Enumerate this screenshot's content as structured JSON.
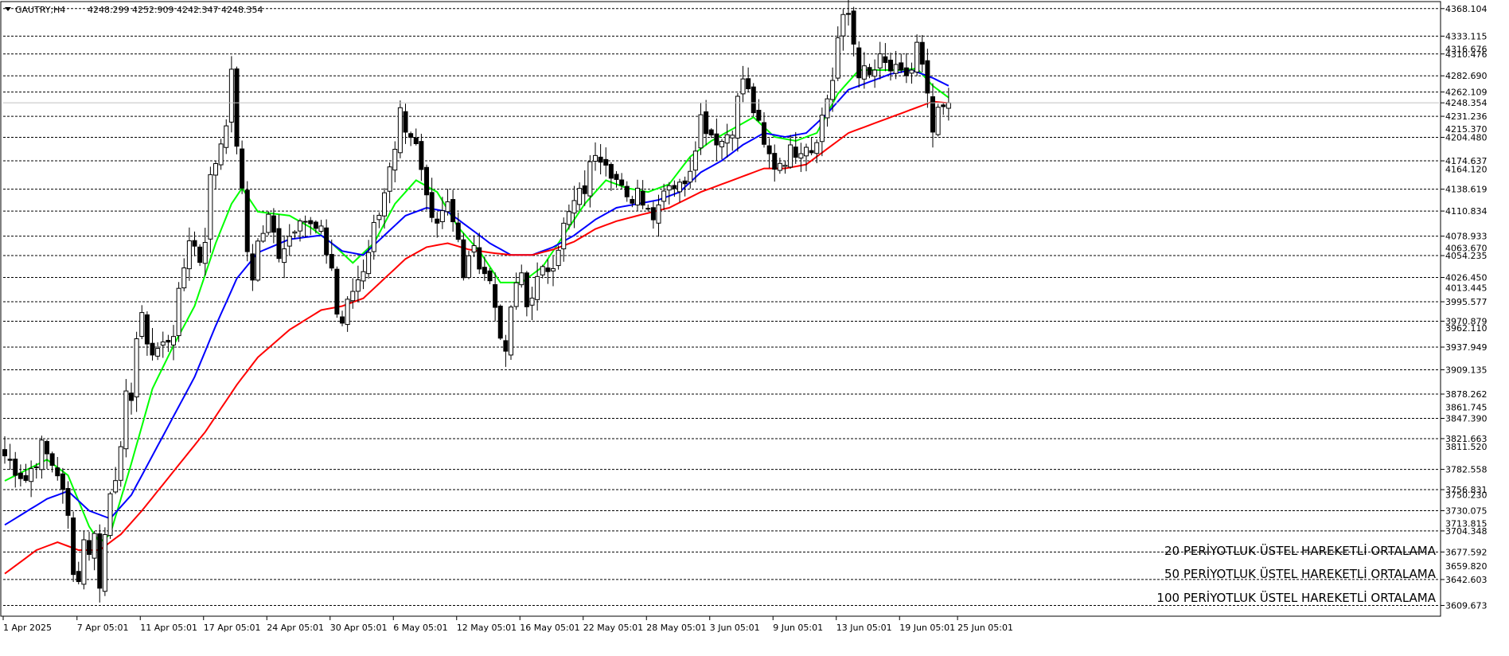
{
  "header": {
    "symbol": "GAUTRY,H4",
    "ohlc": "4248.299 4252.909 4242.347 4248.354",
    "menu_icon": "triangle-down-icon"
  },
  "chart_data": {
    "type": "candlestick",
    "title": "GAUTRY,H4",
    "ylim": [
      3596,
      4377
    ],
    "x_count": 181,
    "current_price": "4248.354",
    "price_levels_dashed": [
      4368.104,
      4333.115,
      4310.476,
      4282.69,
      4262.109,
      4231.236,
      4204.48,
      4174.637,
      4138.619,
      4110.834,
      4078.933,
      4054.235,
      4026.45,
      3995.577,
      3970.879,
      3937.949,
      3909.135,
      3878.262,
      3847.39,
      3821.663,
      3782.558,
      3756.831,
      3730.075,
      3704.348,
      3677.592,
      3642.603,
      3609.673
    ],
    "price_labels_major": [
      "4368.104",
      "4333.115",
      "4310.476",
      "4282.690",
      "4262.109",
      "4248.354",
      "4231.236",
      "4204.480",
      "4174.637",
      "4138.619",
      "4110.834",
      "4078.933",
      "4054.235",
      "4026.450",
      "3995.577",
      "3970.879",
      "3937.949",
      "3909.135",
      "3878.262",
      "3847.390",
      "3821.663",
      "3782.558",
      "3756.831",
      "3730.075",
      "3704.348",
      "3677.592",
      "3642.603",
      "3609.673"
    ],
    "price_labels_minor": [
      "4316.676",
      "4215.370",
      "4164.120",
      "4063.670",
      "4013.445",
      "3962.110",
      "3861.745",
      "3811.520",
      "3750.230",
      "3713.815",
      "3659.820"
    ],
    "x_labels": [
      {
        "label": "1 Apr 2025",
        "i": 0
      },
      {
        "label": "7 Apr 05:01",
        "i": 14
      },
      {
        "label": "11 Apr 05:01",
        "i": 26
      },
      {
        "label": "17 Apr 05:01",
        "i": 38
      },
      {
        "label": "24 Apr 05:01",
        "i": 50
      },
      {
        "label": "30 Apr 05:01",
        "i": 62
      },
      {
        "label": "6 May 05:01",
        "i": 74
      },
      {
        "label": "12 May 05:01",
        "i": 86
      },
      {
        "label": "16 May 05:01",
        "i": 98
      },
      {
        "label": "22 May 05:01",
        "i": 110
      },
      {
        "label": "28 May 05:01",
        "i": 122
      },
      {
        "label": "3 Jun 05:01",
        "i": 134
      },
      {
        "label": "9 Jun 05:01",
        "i": 146
      },
      {
        "label": "13 Jun 05:01",
        "i": 158
      },
      {
        "label": "19 Jun 05:01",
        "i": 170
      },
      {
        "label": "25 Jun 05:01",
        "i": 181
      }
    ],
    "close_path": [
      [
        0,
        3800
      ],
      [
        4,
        3770
      ],
      [
        7,
        3810
      ],
      [
        10,
        3780
      ],
      [
        12,
        3720
      ],
      [
        13,
        3660
      ],
      [
        14,
        3640
      ],
      [
        15,
        3700
      ],
      [
        16,
        3670
      ],
      [
        17,
        3710
      ],
      [
        18,
        3630
      ],
      [
        19,
        3700
      ],
      [
        20,
        3760
      ],
      [
        22,
        3800
      ],
      [
        23,
        3870
      ],
      [
        24,
        3880
      ],
      [
        25,
        3950
      ],
      [
        26,
        3970
      ],
      [
        28,
        3930
      ],
      [
        30,
        3940
      ],
      [
        32,
        3960
      ],
      [
        33,
        4000
      ],
      [
        34,
        4040
      ],
      [
        35,
        4080
      ],
      [
        37,
        4050
      ],
      [
        38,
        4080
      ],
      [
        39,
        4150
      ],
      [
        41,
        4200
      ],
      [
        42,
        4230
      ],
      [
        43,
        4280
      ],
      [
        44,
        4200
      ],
      [
        45,
        4130
      ],
      [
        46,
        4060
      ],
      [
        47,
        4030
      ],
      [
        48,
        4070
      ],
      [
        50,
        4100
      ],
      [
        52,
        4060
      ],
      [
        54,
        4080
      ],
      [
        56,
        4110
      ],
      [
        58,
        4090
      ],
      [
        60,
        4080
      ],
      [
        62,
        4040
      ],
      [
        63,
        3980
      ],
      [
        64,
        3970
      ],
      [
        66,
        4010
      ],
      [
        68,
        4040
      ],
      [
        70,
        4090
      ],
      [
        72,
        4140
      ],
      [
        74,
        4180
      ],
      [
        75,
        4230
      ],
      [
        76,
        4200
      ],
      [
        78,
        4190
      ],
      [
        80,
        4130
      ],
      [
        82,
        4100
      ],
      [
        84,
        4130
      ],
      [
        86,
        4070
      ],
      [
        87,
        4020
      ],
      [
        88,
        4060
      ],
      [
        90,
        4050
      ],
      [
        92,
        4020
      ],
      [
        93,
        3990
      ],
      [
        94,
        3960
      ],
      [
        95,
        3920
      ],
      [
        96,
        3990
      ],
      [
        98,
        4030
      ],
      [
        99,
        3990
      ],
      [
        100,
        4010
      ],
      [
        102,
        4030
      ],
      [
        104,
        4050
      ],
      [
        106,
        4090
      ],
      [
        108,
        4120
      ],
      [
        110,
        4140
      ],
      [
        112,
        4190
      ],
      [
        114,
        4180
      ],
      [
        116,
        4150
      ],
      [
        118,
        4120
      ],
      [
        120,
        4140
      ],
      [
        122,
        4120
      ],
      [
        123,
        4100
      ],
      [
        124,
        4130
      ],
      [
        126,
        4150
      ],
      [
        128,
        4140
      ],
      [
        130,
        4170
      ],
      [
        132,
        4230
      ],
      [
        133,
        4220
      ],
      [
        134,
        4210
      ],
      [
        136,
        4200
      ],
      [
        138,
        4220
      ],
      [
        140,
        4280
      ],
      [
        142,
        4240
      ],
      [
        144,
        4190
      ],
      [
        146,
        4170
      ],
      [
        148,
        4180
      ],
      [
        150,
        4190
      ],
      [
        152,
        4200
      ],
      [
        153,
        4190
      ],
      [
        155,
        4230
      ],
      [
        157,
        4280
      ],
      [
        158,
        4330
      ],
      [
        159,
        4350
      ],
      [
        160,
        4360
      ],
      [
        162,
        4290
      ],
      [
        164,
        4280
      ],
      [
        166,
        4300
      ],
      [
        168,
        4290
      ],
      [
        170,
        4280
      ],
      [
        172,
        4290
      ],
      [
        173,
        4320
      ],
      [
        174,
        4290
      ],
      [
        175,
        4250
      ],
      [
        176,
        4210
      ],
      [
        177,
        4230
      ],
      [
        178,
        4240
      ],
      [
        179,
        4248.354
      ]
    ],
    "series": [
      {
        "name": "20 PERİYOTLUK ÜSTEL HAREKETLİ ORTALAMA",
        "color": "#00ff00",
        "period": 20
      },
      {
        "name": "50 PERİYOTLUK ÜSTEL HAREKETLİ ORTALAMA",
        "color": "#0000ff",
        "period": 50
      },
      {
        "name": "100 PERİYOTLUK ÜSTEL HAREKETLİ ORTALAMA",
        "color": "#ff0000",
        "period": 100
      }
    ],
    "ema_anchor": {
      "ema20": [
        [
          0,
          3768
        ],
        [
          8,
          3795
        ],
        [
          12,
          3775
        ],
        [
          16,
          3710
        ],
        [
          18,
          3690
        ],
        [
          20,
          3700
        ],
        [
          24,
          3790
        ],
        [
          28,
          3885
        ],
        [
          32,
          3940
        ],
        [
          36,
          3990
        ],
        [
          40,
          4070
        ],
        [
          43,
          4120
        ],
        [
          45,
          4140
        ],
        [
          48,
          4110
        ],
        [
          54,
          4105
        ],
        [
          58,
          4090
        ],
        [
          62,
          4070
        ],
        [
          66,
          4045
        ],
        [
          70,
          4070
        ],
        [
          74,
          4120
        ],
        [
          78,
          4150
        ],
        [
          82,
          4135
        ],
        [
          86,
          4090
        ],
        [
          90,
          4060
        ],
        [
          94,
          4020
        ],
        [
          98,
          4020
        ],
        [
          102,
          4040
        ],
        [
          106,
          4080
        ],
        [
          110,
          4120
        ],
        [
          114,
          4150
        ],
        [
          118,
          4140
        ],
        [
          122,
          4135
        ],
        [
          126,
          4145
        ],
        [
          130,
          4180
        ],
        [
          134,
          4200
        ],
        [
          138,
          4215
        ],
        [
          142,
          4230
        ],
        [
          146,
          4205
        ],
        [
          150,
          4200
        ],
        [
          154,
          4210
        ],
        [
          158,
          4260
        ],
        [
          162,
          4290
        ],
        [
          166,
          4290
        ],
        [
          170,
          4290
        ],
        [
          173,
          4292
        ],
        [
          176,
          4270
        ],
        [
          179,
          4255
        ]
      ],
      "ema50": [
        [
          0,
          3712
        ],
        [
          8,
          3745
        ],
        [
          12,
          3755
        ],
        [
          16,
          3730
        ],
        [
          20,
          3720
        ],
        [
          24,
          3750
        ],
        [
          28,
          3800
        ],
        [
          32,
          3850
        ],
        [
          36,
          3900
        ],
        [
          40,
          3965
        ],
        [
          44,
          4025
        ],
        [
          48,
          4058
        ],
        [
          54,
          4075
        ],
        [
          60,
          4080
        ],
        [
          64,
          4060
        ],
        [
          68,
          4055
        ],
        [
          72,
          4080
        ],
        [
          76,
          4105
        ],
        [
          80,
          4115
        ],
        [
          84,
          4110
        ],
        [
          88,
          4090
        ],
        [
          92,
          4070
        ],
        [
          96,
          4055
        ],
        [
          100,
          4055
        ],
        [
          104,
          4065
        ],
        [
          108,
          4080
        ],
        [
          112,
          4100
        ],
        [
          116,
          4115
        ],
        [
          120,
          4120
        ],
        [
          124,
          4125
        ],
        [
          128,
          4135
        ],
        [
          132,
          4160
        ],
        [
          136,
          4175
        ],
        [
          140,
          4195
        ],
        [
          144,
          4210
        ],
        [
          148,
          4205
        ],
        [
          152,
          4210
        ],
        [
          156,
          4235
        ],
        [
          160,
          4265
        ],
        [
          164,
          4275
        ],
        [
          168,
          4285
        ],
        [
          172,
          4290
        ],
        [
          176,
          4280
        ],
        [
          179,
          4270
        ]
      ],
      "ema100": [
        [
          0,
          3650
        ],
        [
          6,
          3680
        ],
        [
          10,
          3690
        ],
        [
          14,
          3680
        ],
        [
          18,
          3680
        ],
        [
          22,
          3700
        ],
        [
          26,
          3730
        ],
        [
          32,
          3780
        ],
        [
          38,
          3830
        ],
        [
          44,
          3890
        ],
        [
          48,
          3925
        ],
        [
          54,
          3960
        ],
        [
          60,
          3985
        ],
        [
          64,
          3990
        ],
        [
          68,
          4000
        ],
        [
          72,
          4025
        ],
        [
          76,
          4050
        ],
        [
          80,
          4065
        ],
        [
          84,
          4070
        ],
        [
          88,
          4062
        ],
        [
          92,
          4058
        ],
        [
          96,
          4055
        ],
        [
          100,
          4055
        ],
        [
          104,
          4062
        ],
        [
          108,
          4072
        ],
        [
          112,
          4088
        ],
        [
          116,
          4098
        ],
        [
          120,
          4105
        ],
        [
          126,
          4115
        ],
        [
          132,
          4135
        ],
        [
          138,
          4150
        ],
        [
          144,
          4165
        ],
        [
          148,
          4165
        ],
        [
          152,
          4170
        ],
        [
          156,
          4190
        ],
        [
          160,
          4210
        ],
        [
          164,
          4220
        ],
        [
          168,
          4230
        ],
        [
          172,
          4240
        ],
        [
          176,
          4250
        ],
        [
          179,
          4248
        ]
      ]
    }
  }
}
